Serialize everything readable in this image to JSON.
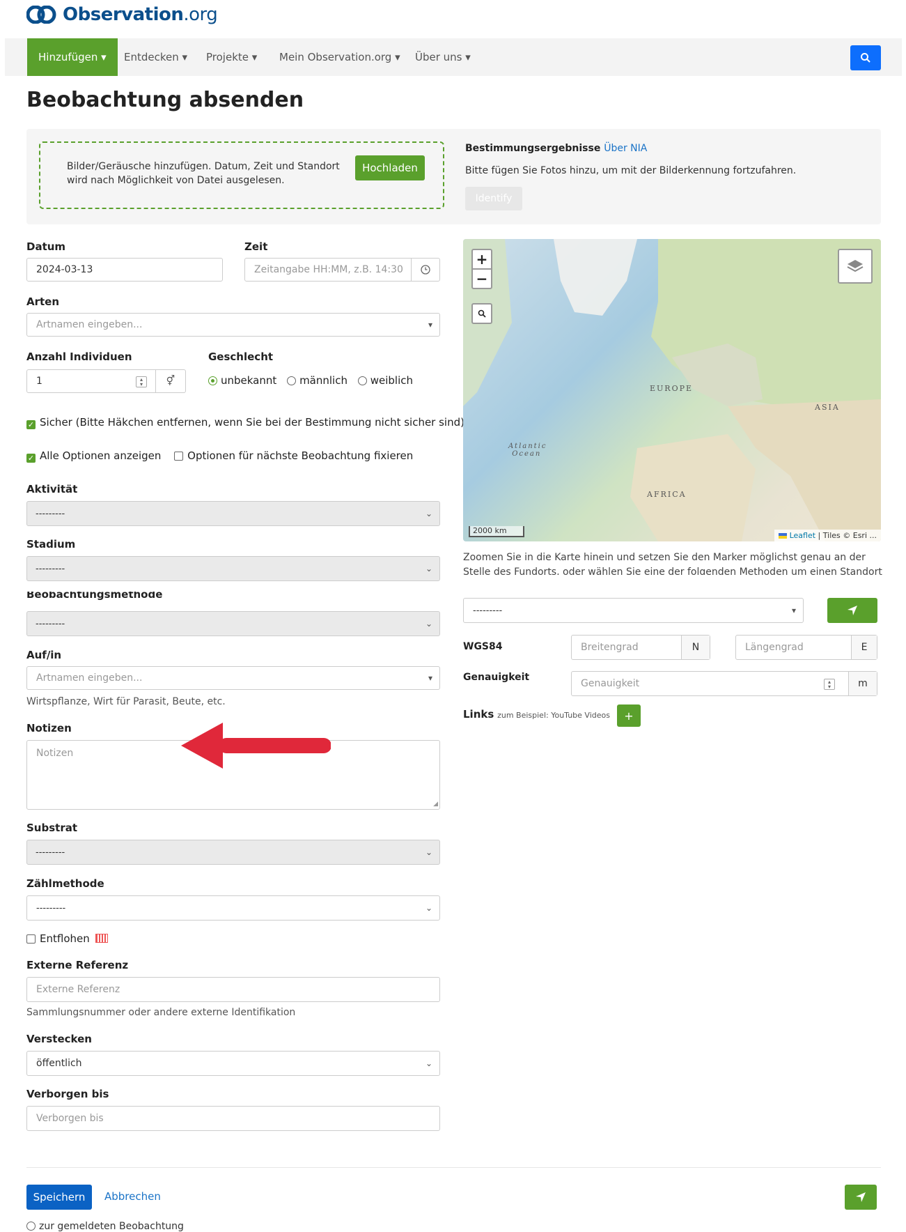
{
  "logo": {
    "brand_bold": "Observation",
    "brand_tld": ".org"
  },
  "nav": {
    "items": [
      {
        "label": "Hinzufügen ▾"
      },
      {
        "label": "Entdecken ▾"
      },
      {
        "label": "Projekte ▾"
      },
      {
        "label": "Mein Observation.org ▾"
      },
      {
        "label": "Über uns ▾"
      }
    ]
  },
  "page": {
    "title": "Beobachtung absenden"
  },
  "upload": {
    "text": "Bilder/Geräusche hinzufügen. Datum, Zeit und Standort wird nach Möglichkeit von Datei ausgelesen.",
    "button": "Hochladen",
    "ident_title": "Bestimmungsergebnisse",
    "ident_link": "Über NIA",
    "ident_text": "Bitte fügen Sie Fotos hinzu, um mit der Bilderkennung fortzufahren.",
    "ident_button": "Identify"
  },
  "form": {
    "date_label": "Datum",
    "date_value": "2024-03-13",
    "time_label": "Zeit",
    "time_placeholder": "Zeitangabe HH:MM, z.B. 14:30",
    "species_label": "Arten",
    "species_placeholder": "Artnamen eingeben...",
    "count_label": "Anzahl Individuen",
    "count_value": "1",
    "sex_label": "Geschlecht",
    "sex_options": [
      "unbekannt",
      "männlich",
      "weiblich"
    ],
    "sure_text": "Sicher (Bitte Häkchen entfernen, wenn Sie bei der Bestimmung nicht sicher sind)",
    "show_all": "Alle Optionen anzeigen",
    "fix_options": "Optionen für nächste Beobachtung fixieren",
    "activity_label": "Aktivität",
    "activity_value": "---------",
    "stage_label": "Stadium",
    "stage_value": "---------",
    "method_label": "Beobachtungsmethode",
    "method_value": "---------",
    "on_label": "Auf/in",
    "on_placeholder": "Artnamen eingeben...",
    "on_help": "Wirtspflanze, Wirt für Parasit, Beute, etc.",
    "notes_label": "Notizen",
    "notes_placeholder": "Notizen",
    "substrate_label": "Substrat",
    "substrate_value": "---------",
    "count_method_label": "Zählmethode",
    "count_method_value": "---------",
    "escaped_label": "Entflohen",
    "ext_ref_label": "Externe Referenz",
    "ext_ref_placeholder": "Externe Referenz",
    "ext_ref_help": "Sammlungsnummer oder andere externe Identifikation",
    "hide_label": "Verstecken",
    "hide_value": "öffentlich",
    "hidden_until_label": "Verborgen bis",
    "hidden_until_placeholder": "Verborgen bis"
  },
  "map": {
    "zoom_in": "+",
    "zoom_out": "−",
    "labels": {
      "europe": "EUROPE",
      "asia": "ASIA",
      "atlantic1": "Atlantic",
      "atlantic2": "Ocean",
      "africa": "AFRICA"
    },
    "scale": "2000 km",
    "attrib_leaflet": "Leaflet",
    "attrib_rest": " | Tiles © Esri ...",
    "instructions": "Zoomen Sie in die Karte hinein und setzen Sie den Marker möglichst genau an der Stelle des Fundorts, oder wählen Sie eine der folgenden Methoden um einen Standort auszuwählen",
    "method_value": "---------",
    "wgs_label": "WGS84",
    "lat_placeholder": "Breitengrad",
    "lat_suffix": "N",
    "lon_placeholder": "Längengrad",
    "lon_suffix": "E",
    "acc_label": "Genauigkeit",
    "acc_placeholder": "Genauigkeit",
    "acc_suffix": "m",
    "links_label": "Links",
    "links_help": "zum Beispiel: YouTube Videos",
    "links_add": "+"
  },
  "footer": {
    "save": "Speichern",
    "cancel": "Abbrechen",
    "goto": "zur gemeldeten Beobachtung"
  },
  "colors": {
    "green": "#5aa02c",
    "blue": "#0d6efd",
    "arrow": "#e0283a"
  }
}
